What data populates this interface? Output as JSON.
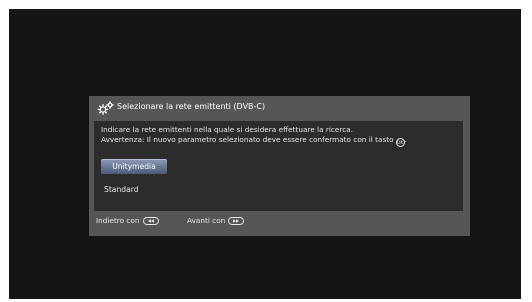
{
  "dialog": {
    "title": "Selezionare la rete emittenti (DVB-C)",
    "title_icon": "settings-gears-icon",
    "message_line1": "Indicare la rete emittenti nella quale si desidera effettuare la ricerca.",
    "message_line2": "Avvertenza: Il nuovo parametro selezionato deve essere confermato con il tasto",
    "ok_key_icon": "ok-key-icon",
    "ok_key_text": "OK",
    "options": [
      {
        "label": "Unitymedia",
        "selected": true
      },
      {
        "label": "Standard",
        "selected": false
      }
    ]
  },
  "footer": {
    "back_label": "Indietro con",
    "back_icon": "rewind-key-icon",
    "next_label": "Avanti con",
    "next_icon": "fast-forward-key-icon"
  },
  "colors": {
    "screen_background": "#151515",
    "dialog_frame": "#565656",
    "dialog_body": "#2c2c2c",
    "selected_option": "#6b7897",
    "text": "#e8e8e8"
  }
}
